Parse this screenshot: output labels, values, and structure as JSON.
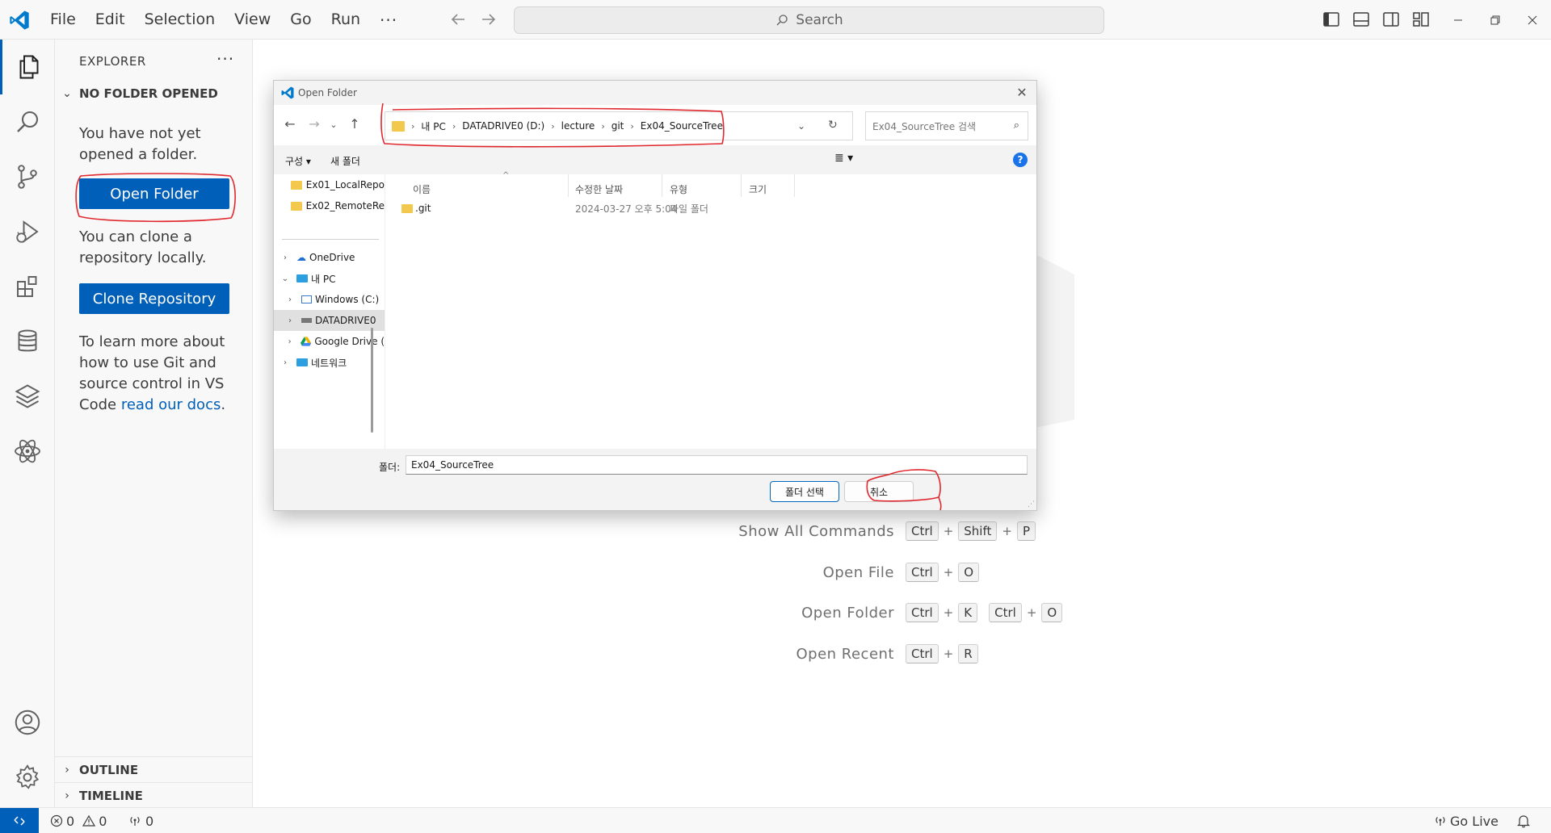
{
  "menu": {
    "items": [
      "File",
      "Edit",
      "Selection",
      "View",
      "Go",
      "Run"
    ],
    "more": "···"
  },
  "search": {
    "label": "Search"
  },
  "sidebar": {
    "title": "EXPLORER",
    "more": "···",
    "section": "NO FOLDER OPENED",
    "text1": "You have not yet opened a folder.",
    "open_folder": "Open Folder",
    "text2": "You can clone a repository locally.",
    "clone": "Clone Repository",
    "text3": "To learn more about how to use Git and source control in VS Code",
    "link": "read our docs",
    "text3_end": ".",
    "outline": "OUTLINE",
    "timeline": "TIMELINE"
  },
  "shortcuts": [
    {
      "label": "Show All Commands",
      "keys": [
        "Ctrl",
        "Shift",
        "P"
      ]
    },
    {
      "label": "Open File",
      "keys": [
        "Ctrl",
        "O"
      ]
    },
    {
      "label": "Open Folder",
      "keys": [
        "Ctrl",
        "K"
      ],
      "keys2": [
        "Ctrl",
        "O"
      ]
    },
    {
      "label": "Open Recent",
      "keys": [
        "Ctrl",
        "R"
      ]
    }
  ],
  "statusbar": {
    "errors": "0",
    "warnings": "0",
    "ports": "0",
    "golive": "Go Live"
  },
  "dialog": {
    "title": "Open Folder",
    "breadcrumb": [
      "내 PC",
      "DATADRIVE0 (D:)",
      "lecture",
      "git",
      "Ex04_SourceTree"
    ],
    "search_placeholder": "Ex04_SourceTree 검색",
    "organize": "구성",
    "new_folder": "새 폴더",
    "tree": [
      {
        "label": "Ex01_LocalRepo",
        "kind": "folder"
      },
      {
        "label": "Ex02_RemoteRe",
        "kind": "folder"
      },
      {
        "label": "OneDrive",
        "kind": "cloud"
      },
      {
        "label": "내 PC",
        "kind": "pc"
      },
      {
        "label": "Windows  (C:)",
        "kind": "drive"
      },
      {
        "label": "DATADRIVE0",
        "kind": "drive"
      },
      {
        "label": "Google Drive (",
        "kind": "gdrive"
      },
      {
        "label": "네트워크",
        "kind": "network"
      }
    ],
    "columns": [
      "이름",
      "수정한 날짜",
      "유형",
      "크기"
    ],
    "files": [
      {
        "name": ".git",
        "date": "2024-03-27 오후 5:04",
        "type": "파일 폴더",
        "size": ""
      }
    ],
    "folder_label": "폴더:",
    "folder_value": "Ex04_SourceTree",
    "select_btn": "폴더 선택",
    "cancel_btn": "취소"
  },
  "colors": {
    "accent": "#005fb8",
    "annotation": "#e0282e",
    "folder": "#f2c94c"
  }
}
